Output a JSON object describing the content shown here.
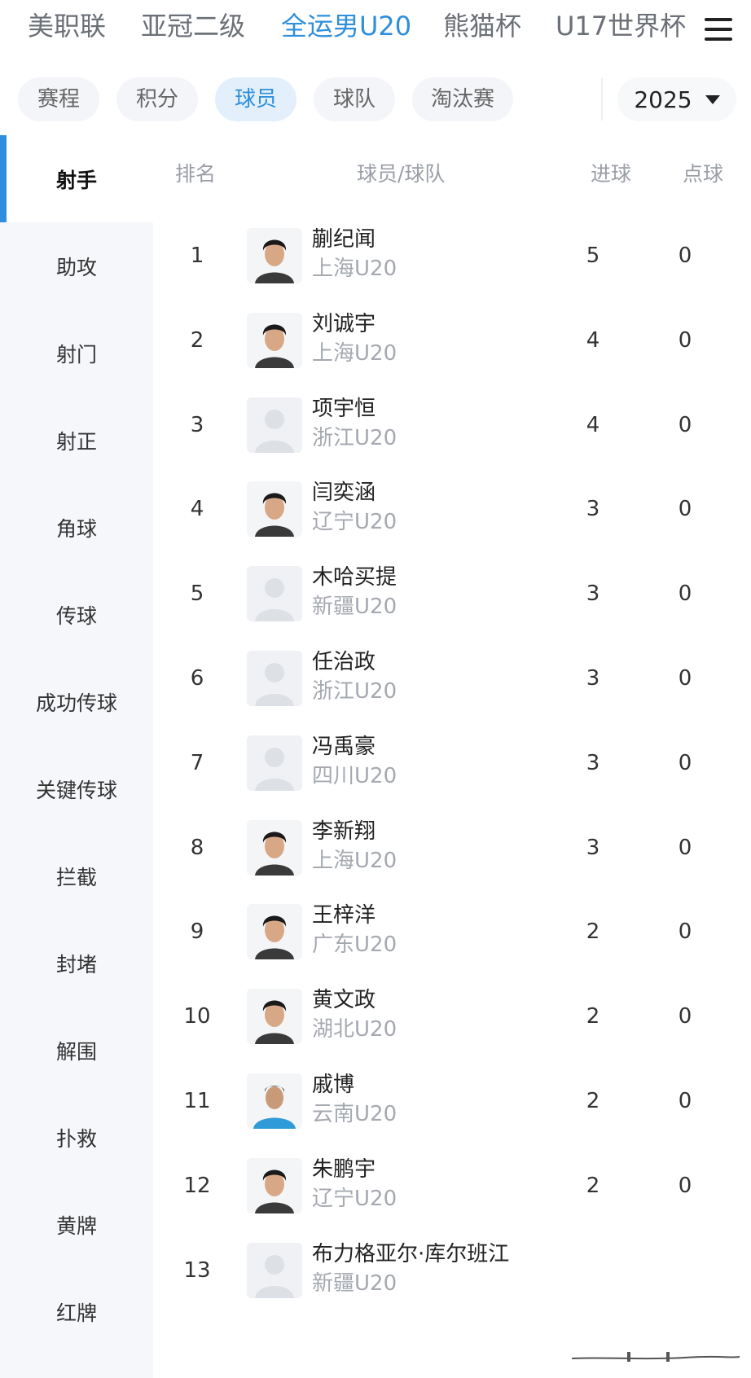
{
  "league_tabs": [
    {
      "label": "美职联",
      "active": false
    },
    {
      "label": "亚冠二级",
      "active": false
    },
    {
      "label": "全运男U20",
      "active": true
    },
    {
      "label": "熊猫杯",
      "active": false
    },
    {
      "label": "U17世界杯",
      "active": false
    }
  ],
  "menu_icon": "hamburger-menu-icon",
  "sub_tabs": [
    {
      "label": "赛程",
      "active": false
    },
    {
      "label": "积分",
      "active": false
    },
    {
      "label": "球员",
      "active": true
    },
    {
      "label": "球队",
      "active": false
    },
    {
      "label": "淘汰赛",
      "active": false
    }
  ],
  "season_select": {
    "value": "2025",
    "icon": "caret-down-icon"
  },
  "stat_categories": [
    {
      "label": "射手",
      "active": true
    },
    {
      "label": "助攻",
      "active": false
    },
    {
      "label": "射门",
      "active": false
    },
    {
      "label": "射正",
      "active": false
    },
    {
      "label": "角球",
      "active": false
    },
    {
      "label": "传球",
      "active": false
    },
    {
      "label": "成功传球",
      "active": false
    },
    {
      "label": "关键传球",
      "active": false
    },
    {
      "label": "拦截",
      "active": false
    },
    {
      "label": "封堵",
      "active": false
    },
    {
      "label": "解围",
      "active": false
    },
    {
      "label": "扑救",
      "active": false
    },
    {
      "label": "黄牌",
      "active": false
    },
    {
      "label": "红牌",
      "active": false
    }
  ],
  "table_header": {
    "rank": "排名",
    "player_team": "球员/球队",
    "goals": "进球",
    "penalties": "点球"
  },
  "players": [
    {
      "rank": "1",
      "name": "蒯纪闻",
      "team": "上海U20",
      "goals": "5",
      "penalties": "0",
      "photo": "photo"
    },
    {
      "rank": "2",
      "name": "刘诚宇",
      "team": "上海U20",
      "goals": "4",
      "penalties": "0",
      "photo": "photo"
    },
    {
      "rank": "3",
      "name": "项宇恒",
      "team": "浙江U20",
      "goals": "4",
      "penalties": "0",
      "photo": "placeholder"
    },
    {
      "rank": "4",
      "name": "闫奕涵",
      "team": "辽宁U20",
      "goals": "3",
      "penalties": "0",
      "photo": "photo"
    },
    {
      "rank": "5",
      "name": "木哈买提",
      "team": "新疆U20",
      "goals": "3",
      "penalties": "0",
      "photo": "placeholder"
    },
    {
      "rank": "6",
      "name": "任治政",
      "team": "浙江U20",
      "goals": "3",
      "penalties": "0",
      "photo": "placeholder"
    },
    {
      "rank": "7",
      "name": "冯禹豪",
      "team": "四川U20",
      "goals": "3",
      "penalties": "0",
      "photo": "placeholder"
    },
    {
      "rank": "8",
      "name": "李新翔",
      "team": "上海U20",
      "goals": "3",
      "penalties": "0",
      "photo": "photo"
    },
    {
      "rank": "9",
      "name": "王梓洋",
      "team": "广东U20",
      "goals": "2",
      "penalties": "0",
      "photo": "photo"
    },
    {
      "rank": "10",
      "name": "黄文政",
      "team": "湖北U20",
      "goals": "2",
      "penalties": "0",
      "photo": "photo"
    },
    {
      "rank": "11",
      "name": "戚博",
      "team": "云南U20",
      "goals": "2",
      "penalties": "0",
      "photo": "photo-blue"
    },
    {
      "rank": "12",
      "name": "朱鹏宇",
      "team": "辽宁U20",
      "goals": "2",
      "penalties": "0",
      "photo": "photo"
    },
    {
      "rank": "13",
      "name": "布力格亚尔·库尔班江",
      "team": "新疆U20",
      "goals": "",
      "penalties": "",
      "photo": "placeholder"
    }
  ],
  "colors": {
    "accent": "#2f8fdc",
    "sidebar_bg": "#f5f7fa",
    "muted_text": "#a5a9b0"
  }
}
